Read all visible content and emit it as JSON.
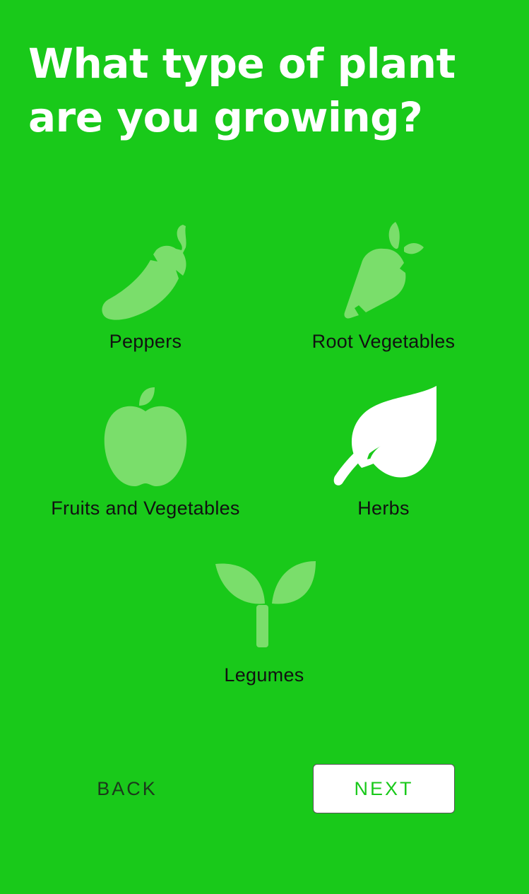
{
  "question": {
    "title": "What type of plant are you growing?"
  },
  "options": [
    {
      "label": "Peppers",
      "icon": "pepper-icon",
      "selected": false
    },
    {
      "label": "Root Vegetables",
      "icon": "carrot-icon",
      "selected": false
    },
    {
      "label": "Fruits and Vegetables",
      "icon": "apple-icon",
      "selected": false
    },
    {
      "label": "Herbs",
      "icon": "leaf-icon",
      "selected": true
    },
    {
      "label": "Legumes",
      "icon": "sprout-icon",
      "selected": false
    }
  ],
  "navigation": {
    "back_label": "BACK",
    "next_label": "NEXT"
  },
  "colors": {
    "background": "#19c91a",
    "icon_unselected": "#7ade6b",
    "icon_selected": "#ffffff",
    "label_text": "#111111",
    "next_text": "#19c91a"
  }
}
